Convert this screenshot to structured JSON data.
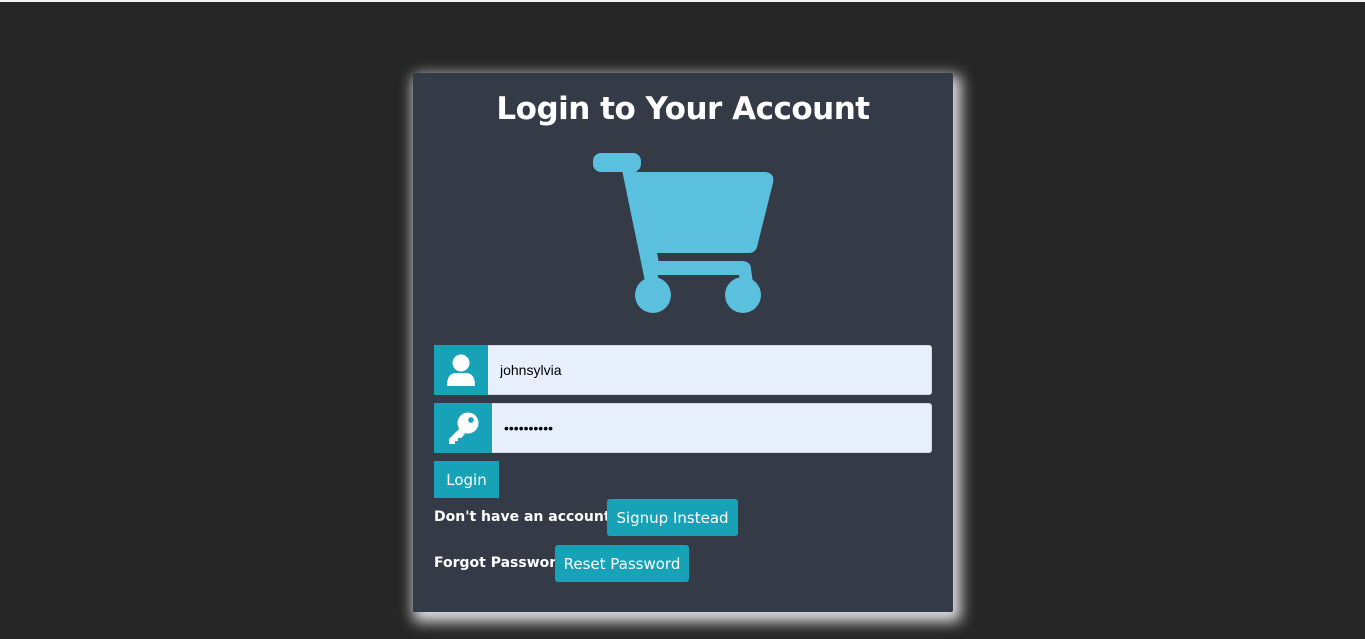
{
  "login": {
    "title": "Login to Your Account",
    "username_value": "johnsylvia",
    "password_value": "••••••••••",
    "login_label": "Login",
    "no_account_text": "Don't have an account?",
    "signup_label": "Signup Instead",
    "forgot_text": "Forgot Password",
    "reset_label": "Reset Password"
  },
  "icons": {
    "cart": "shopping-cart-icon",
    "user": "user-icon",
    "key": "key-icon"
  },
  "colors": {
    "background": "#262626",
    "card": "#343a46",
    "accent": "#17a2b8",
    "cart": "#5bc0de",
    "input_bg": "#e8f0fe"
  }
}
